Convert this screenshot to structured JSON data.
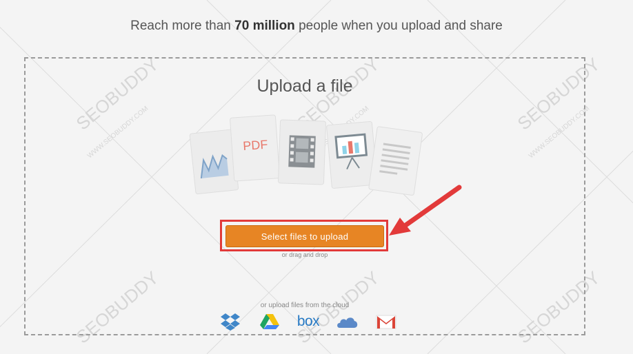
{
  "headline": {
    "prefix": "Reach more than ",
    "highlight": "70 million",
    "suffix": " people when you upload and share"
  },
  "upload": {
    "title": "Upload a file",
    "button_label": "Select files to upload",
    "drag_hint": "or drag and drop",
    "cloud_hint": "or upload files from the cloud",
    "accent_color": "#e78524",
    "highlight_color": "#e23a3a"
  },
  "illustration": {
    "pdf_label": "PDF"
  },
  "cloud_providers": [
    {
      "name": "Dropbox",
      "icon": "dropbox-icon"
    },
    {
      "name": "Google Drive",
      "icon": "google-drive-icon"
    },
    {
      "name": "Box",
      "icon": "box-icon",
      "label": "box"
    },
    {
      "name": "OneDrive",
      "icon": "onedrive-icon"
    },
    {
      "name": "Gmail",
      "icon": "gmail-icon"
    }
  ],
  "watermark": {
    "brand": "SEOBUDDY",
    "domain": "WWW.SEOBUDDY.COM"
  }
}
